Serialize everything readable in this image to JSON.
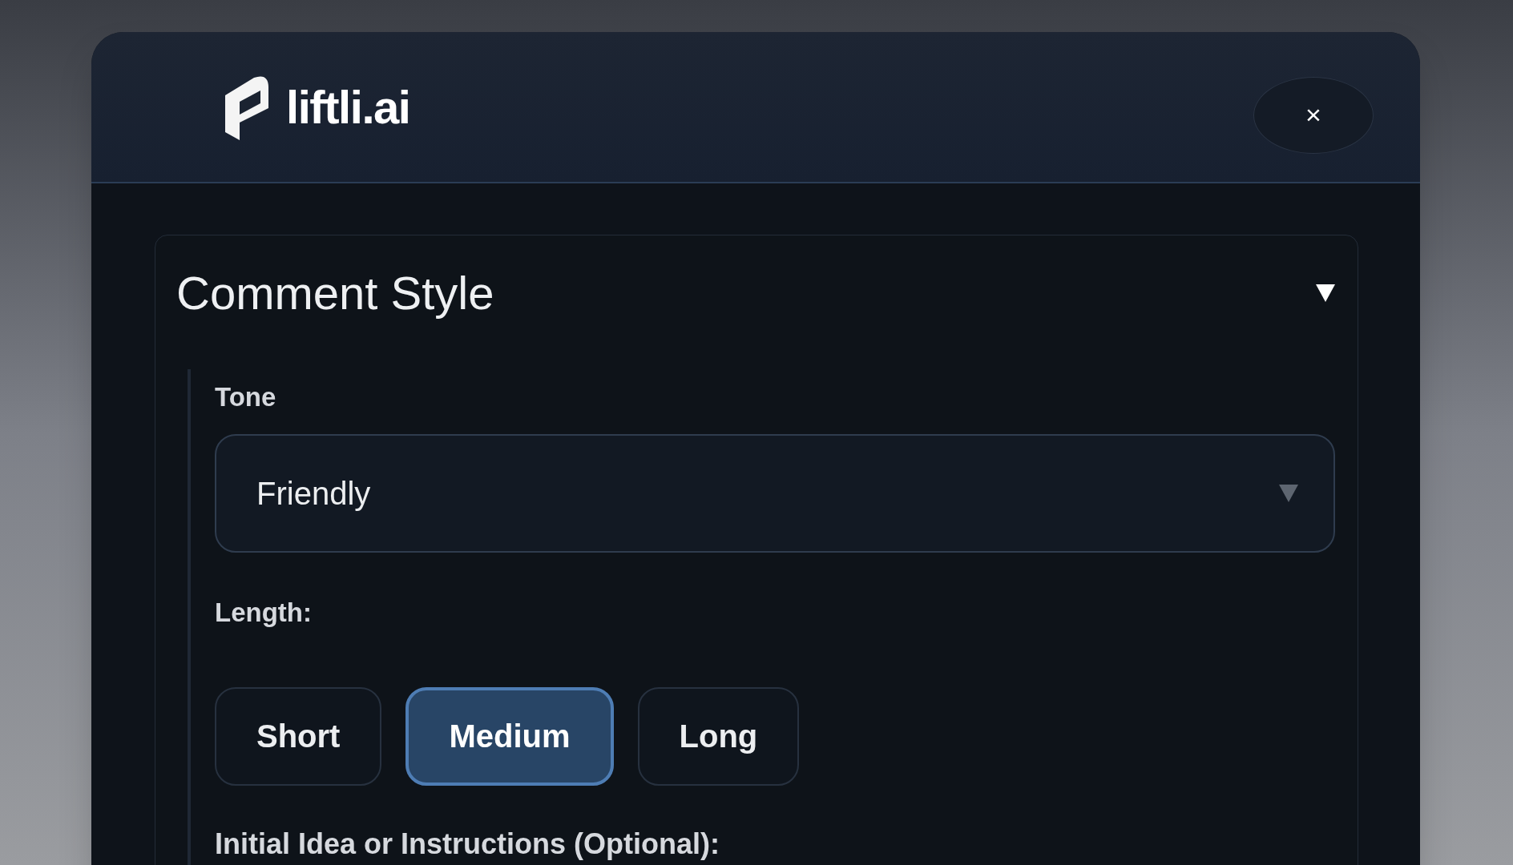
{
  "header": {
    "brand": "liftli.ai",
    "close": "×"
  },
  "section": {
    "title": "Comment Style",
    "expanded": true,
    "tone": {
      "label": "Tone",
      "value": "Friendly"
    },
    "length": {
      "label": "Length:",
      "options": [
        {
          "label": "Short",
          "selected": false
        },
        {
          "label": "Medium",
          "selected": true
        },
        {
          "label": "Long",
          "selected": false
        }
      ]
    },
    "instructions": {
      "label": "Initial Idea or Instructions (Optional):"
    }
  }
}
